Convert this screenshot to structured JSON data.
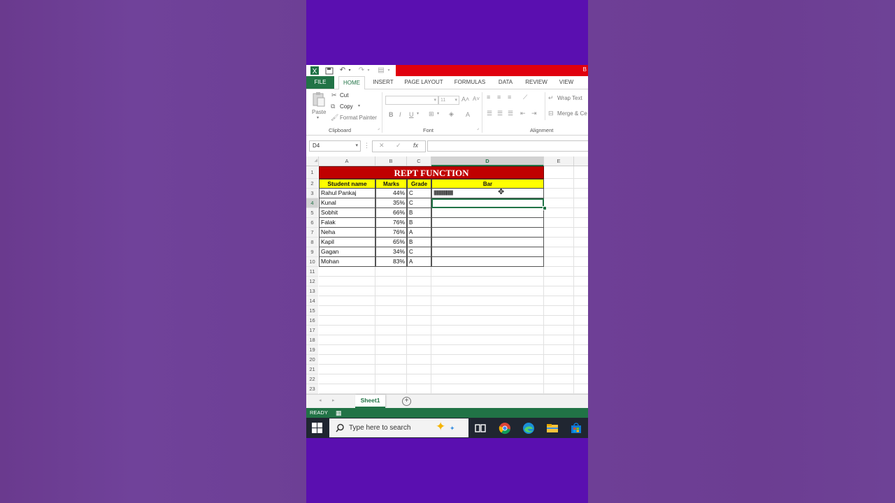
{
  "app": {
    "title_fragment": "B",
    "ribbon_tabs": [
      "FILE",
      "HOME",
      "INSERT",
      "PAGE LAYOUT",
      "FORMULAS",
      "DATA",
      "REVIEW",
      "VIEW"
    ],
    "clipboard": {
      "paste": "Paste",
      "cut": "Cut",
      "copy": "Copy",
      "format_painter": "Format Painter",
      "group": "Clipboard"
    },
    "font": {
      "size": "11",
      "group": "Font"
    },
    "alignment": {
      "wrap": "Wrap Text",
      "merge": "Merge & Ce",
      "group": "Alignment"
    },
    "name_box": "D4",
    "fx": "fx"
  },
  "sheet": {
    "columns": [
      "A",
      "B",
      "C",
      "D",
      "E"
    ],
    "row_numbers": [
      "1",
      "2",
      "3",
      "4",
      "5",
      "6",
      "7",
      "8",
      "9",
      "10",
      "11",
      "12",
      "13",
      "14",
      "15",
      "16",
      "17",
      "18",
      "19",
      "20",
      "21",
      "22",
      "23"
    ],
    "title": "REPT FUNCTION",
    "headers": {
      "name": "Student name",
      "marks": "Marks",
      "grade": "Grade",
      "bar": "Bar"
    },
    "rows": [
      {
        "name": "Rahul Pankaj",
        "marks": "44%",
        "grade": "C",
        "bar": "||||||||||||||||||||||||||||||||||||||||||||"
      },
      {
        "name": "Kunal",
        "marks": "35%",
        "grade": "C",
        "bar": ""
      },
      {
        "name": "Sobhit",
        "marks": "66%",
        "grade": "B",
        "bar": ""
      },
      {
        "name": "Falak",
        "marks": "76%",
        "grade": "B",
        "bar": ""
      },
      {
        "name": "Neha",
        "marks": "76%",
        "grade": "A",
        "bar": ""
      },
      {
        "name": "Kapil",
        "marks": "65%",
        "grade": "B",
        "bar": ""
      },
      {
        "name": "Gagan",
        "marks": "34%",
        "grade": "C",
        "bar": ""
      },
      {
        "name": "Mohan",
        "marks": "83%",
        "grade": "A",
        "bar": ""
      }
    ],
    "sheet_tab": "Sheet1",
    "status": "READY"
  },
  "taskbar": {
    "search_placeholder": "Type here to search"
  },
  "colors": {
    "excel_green": "#217346",
    "title_fill": "#c00000",
    "header_fill": "#ffff00",
    "page_purple": "#5a0fb0"
  }
}
